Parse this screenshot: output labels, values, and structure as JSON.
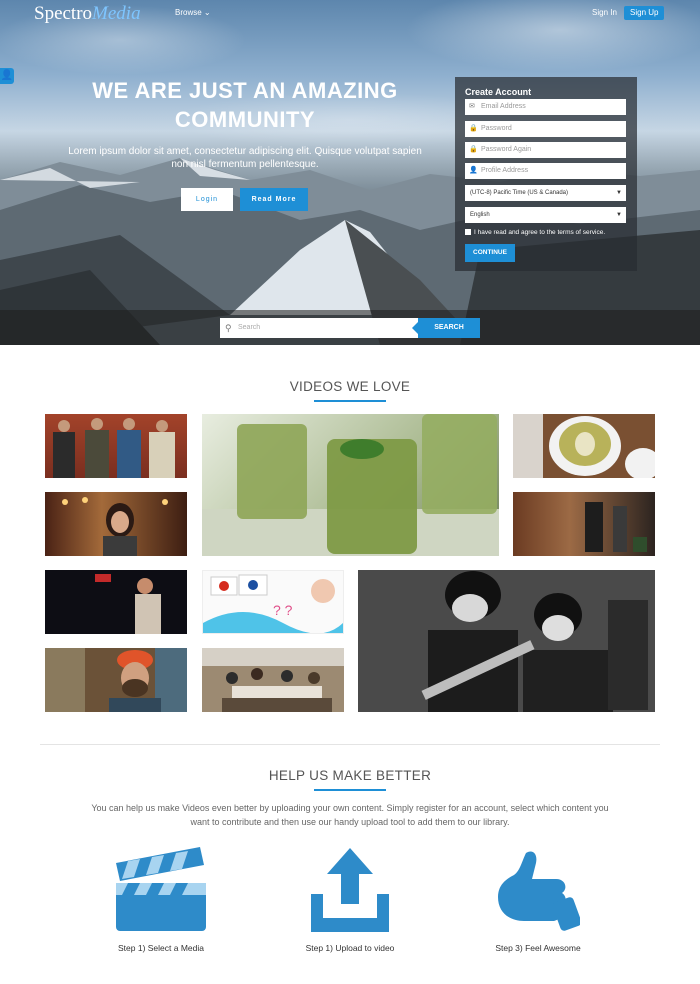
{
  "nav": {
    "logo_a": "Spectro",
    "logo_b": "Media",
    "browse": "Browse",
    "sign_in": "Sign In",
    "sign_up": "Sign Up"
  },
  "hero": {
    "title": "WE ARE JUST AN AMAZING COMMUNITY",
    "subtitle": "Lorem ipsum dolor sit amet, consectetur adipiscing elit. Quisque volutpat sapien non nisl fermentum pellentesque.",
    "login_label": "Login",
    "read_more_label": "Read More"
  },
  "create_account": {
    "title": "Create Account",
    "email_placeholder": "Email Address",
    "password_placeholder": "Password",
    "password_again_placeholder": "Password Again",
    "profile_placeholder": "Profile Address",
    "timezone": "(UTC-8) Pacific Time (US & Canada)",
    "language": "English",
    "terms_prefix": "I have read and agree to the",
    "terms_link": "terms of service.",
    "continue_label": "CONTINUE"
  },
  "search": {
    "placeholder": "Search",
    "button": "SEARCH"
  },
  "videos": {
    "heading": "VIDEOS WE LOVE",
    "tiles": [
      "band-photo",
      "green-smoothies",
      "latte-art",
      "carousel-woman",
      "beer-tap",
      "performer",
      "flags-illustration",
      "beatles-performance",
      "bearded-man",
      "group-dinner"
    ]
  },
  "help": {
    "heading": "HELP US MAKE BETTER",
    "text": "You can help us make Videos even better by uploading your own content. Simply register for an account, select which content you want to contribute and then use our handy upload tool to add them to our library.",
    "steps": [
      {
        "label": "Step 1) Select a Media",
        "icon": "clapperboard-icon"
      },
      {
        "label": "Step 1) Upload to video",
        "icon": "upload-icon"
      },
      {
        "label": "Step 3) Feel Awesome",
        "icon": "thumbs-up-icon"
      }
    ]
  },
  "colors": {
    "accent": "#1e8fd6"
  }
}
